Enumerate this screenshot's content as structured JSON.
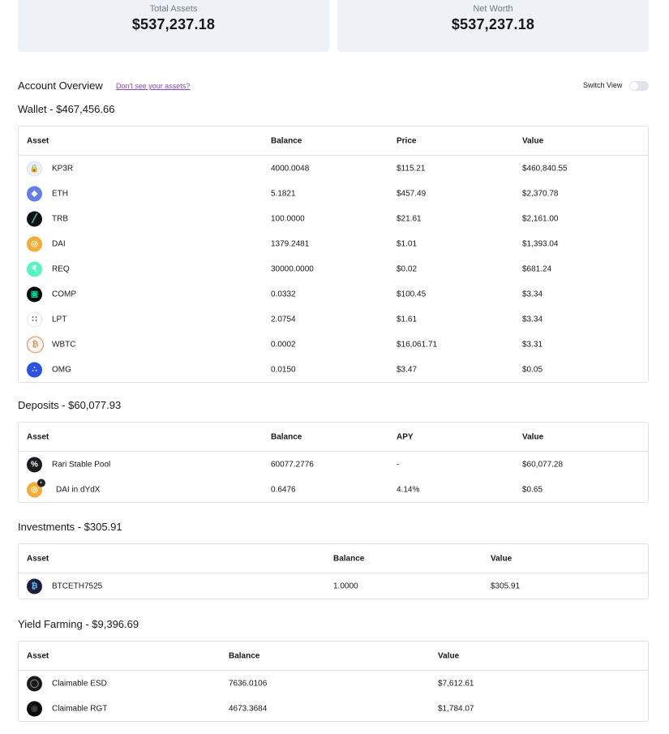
{
  "summary": {
    "total_assets_label": "Total Assets",
    "total_assets_value": "$537,237.18",
    "net_worth_label": "Net Worth",
    "net_worth_value": "$537,237.18"
  },
  "overview": {
    "title": "Account Overview",
    "missing_assets_link": "Don't see your assets?",
    "switch_view_label": "Switch View",
    "switch_view_on": false
  },
  "wallet": {
    "title": "Wallet - $467,456.66",
    "columns": [
      "Asset",
      "Balance",
      "Price",
      "Value"
    ],
    "rows": [
      {
        "asset": "KP3R",
        "balance": "4000.0048",
        "price": "$115.21",
        "value": "$460,840.55",
        "icon": "lock-icon",
        "color": "#e9f0f8"
      },
      {
        "asset": "ETH",
        "balance": "5.1821",
        "price": "$457.49",
        "value": "$2,370.78",
        "icon": "ethereum-icon",
        "color": "#627eea"
      },
      {
        "asset": "TRB",
        "balance": "100.0000",
        "price": "$21.61",
        "value": "$2,161.00",
        "icon": "tellor-icon",
        "color": "#0d1117"
      },
      {
        "asset": "DAI",
        "balance": "1379.2481",
        "price": "$1.01",
        "value": "$1,393.04",
        "icon": "dai-icon",
        "color": "#f5ac37"
      },
      {
        "asset": "REQ",
        "balance": "30000.0000",
        "price": "$0.02",
        "value": "$681.24",
        "icon": "request-icon",
        "color": "#56f5c1"
      },
      {
        "asset": "COMP",
        "balance": "0.0332",
        "price": "$100.45",
        "value": "$3.34",
        "icon": "compound-icon",
        "color": "#070a0e"
      },
      {
        "asset": "LPT",
        "balance": "2.0754",
        "price": "$1.61",
        "value": "$3.34",
        "icon": "livepeer-icon",
        "color": "#ffffff"
      },
      {
        "asset": "WBTC",
        "balance": "0.0002",
        "price": "$16,061.71",
        "value": "$3.31",
        "icon": "wbtc-icon",
        "color": "#f7f7f7"
      },
      {
        "asset": "OMG",
        "balance": "0.0150",
        "price": "$3.47",
        "value": "$0.05",
        "icon": "omg-icon",
        "color": "#2a52e5"
      }
    ]
  },
  "deposits": {
    "title": "Deposits - $60,077.93",
    "columns": [
      "Asset",
      "Balance",
      "APY",
      "Value"
    ],
    "rows": [
      {
        "asset": "Rari Stable Pool",
        "balance": "60077.2776",
        "apy": "-",
        "value": "$60,077.28",
        "icon": "rari-icon",
        "color": "#1b1d21"
      },
      {
        "asset": "DAI in dYdX",
        "balance": "0.6476",
        "apy": "4.14%",
        "value": "$0.65",
        "icon": "dai-icon",
        "color": "#f5ac37",
        "badge": "dydx-badge-icon"
      }
    ]
  },
  "investments": {
    "title": "Investments - $305.91",
    "columns": [
      "Asset",
      "Balance",
      "Value"
    ],
    "rows": [
      {
        "asset": "BTCETH7525",
        "balance": "1.0000",
        "value": "$305.91",
        "icon": "btceth-icon",
        "color": "#1f1f3a"
      }
    ]
  },
  "yield_farming": {
    "title": "Yield Farming - $9,396.69",
    "columns": [
      "Asset",
      "Balance",
      "Value"
    ],
    "rows": [
      {
        "asset": "Claimable ESD",
        "balance": "7636.0106",
        "value": "$7,612.61",
        "icon": "esd-icon",
        "color": "#1a1a1a"
      },
      {
        "asset": "Claimable RGT",
        "balance": "4673.3684",
        "value": "$1,784.07",
        "icon": "rgt-icon",
        "color": "#0c0c0c"
      }
    ]
  }
}
